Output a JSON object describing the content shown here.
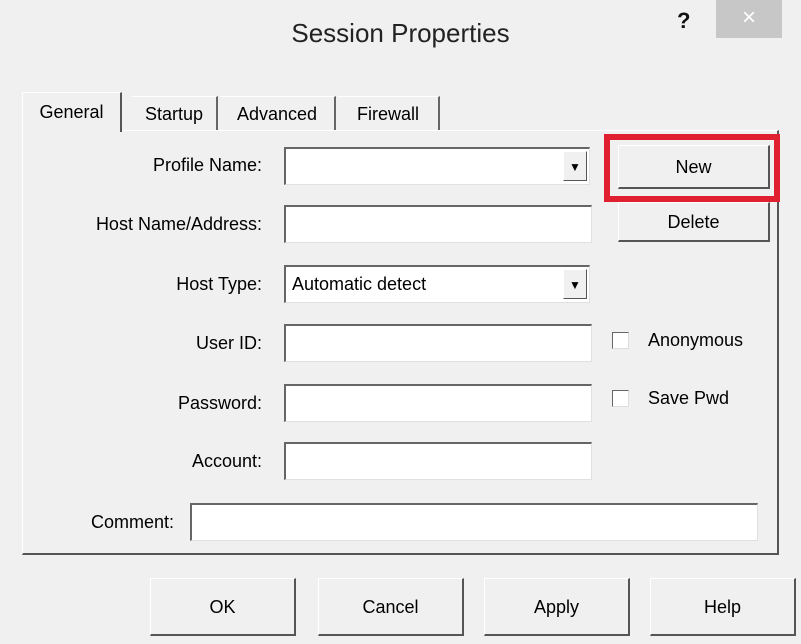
{
  "window": {
    "title": "Session Properties",
    "help_label": "?",
    "close_label": "×"
  },
  "tabs": [
    {
      "label": "General",
      "active": true
    },
    {
      "label": "Startup",
      "active": false
    },
    {
      "label": "Advanced",
      "active": false
    },
    {
      "label": "Firewall",
      "active": false
    }
  ],
  "form": {
    "profile_name": {
      "label": "Profile Name:",
      "value": ""
    },
    "host_name": {
      "label": "Host Name/Address:",
      "value": ""
    },
    "host_type": {
      "label": "Host Type:",
      "value": "Automatic detect"
    },
    "user_id": {
      "label": "User ID:",
      "value": ""
    },
    "password": {
      "label": "Password:",
      "value": ""
    },
    "account": {
      "label": "Account:",
      "value": ""
    },
    "comment": {
      "label": "Comment:",
      "value": ""
    }
  },
  "side_buttons": {
    "new": "New",
    "delete": "Delete"
  },
  "checkboxes": {
    "anonymous": {
      "label": "Anonymous",
      "checked": false
    },
    "save_pwd": {
      "label": "Save Pwd",
      "checked": false
    }
  },
  "highlight_color": "#e02030",
  "bottom_buttons": {
    "ok": "OK",
    "cancel": "Cancel",
    "apply": "Apply",
    "help": "Help"
  }
}
